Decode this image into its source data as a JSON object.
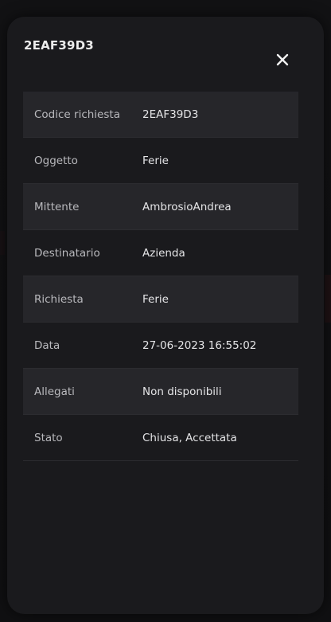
{
  "modal": {
    "title": "2EAF39D3",
    "close_icon": "close-icon"
  },
  "details": [
    {
      "label": "Codice richiesta",
      "value": "2EAF39D3"
    },
    {
      "label": "Oggetto",
      "value": "Ferie"
    },
    {
      "label": "Mittente",
      "value": "AmbrosioAndrea"
    },
    {
      "label": "Destinatario",
      "value": "Azienda"
    },
    {
      "label": "Richiesta",
      "value": "Ferie"
    },
    {
      "label": "Data",
      "value": "27-06-2023 16:55:02"
    },
    {
      "label": "Allegati",
      "value": "Non disponibili"
    },
    {
      "label": "Stato",
      "value": "Chiusa, Accettata"
    }
  ],
  "colors": {
    "modal_background": "#1a1a1d",
    "shaded_row": "#26262a",
    "text_primary": "#e4e4e6",
    "text_secondary": "#b9b9bd"
  }
}
